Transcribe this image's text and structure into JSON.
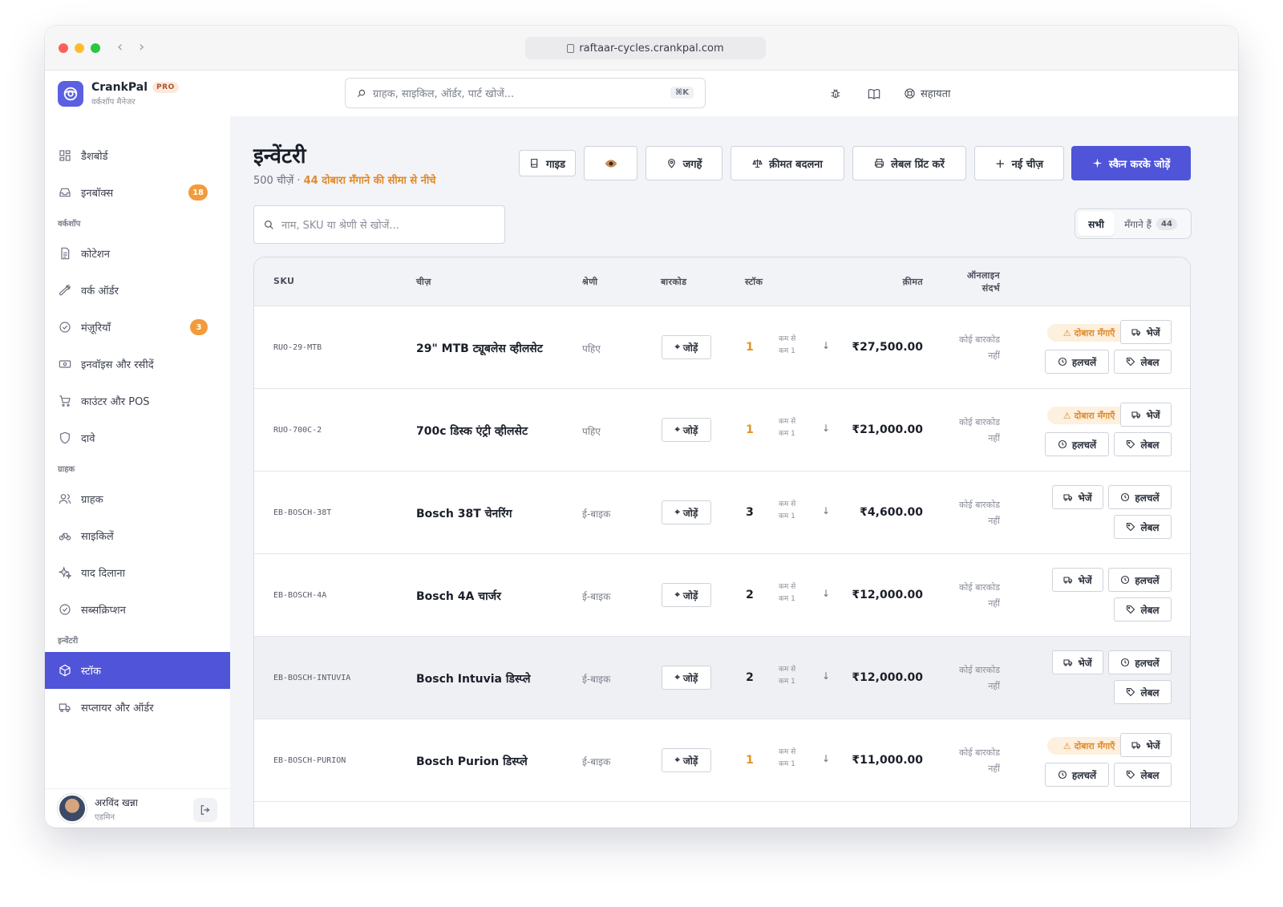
{
  "browser": {
    "url": "raftaar-cycles.crankpal.com"
  },
  "brand": {
    "name": "CrankPal",
    "badge": "PRO",
    "subtitle": "वर्कशॉप मैनेजर"
  },
  "sidebar": {
    "items": [
      {
        "label": "डैशबोर्ड"
      },
      {
        "label": "इनबॉक्स",
        "badge": "18"
      },
      {
        "section": "वर्कशॉप"
      },
      {
        "label": "कोटेशन"
      },
      {
        "label": "वर्क ऑर्डर"
      },
      {
        "label": "मंज़ूरियाँ",
        "badge": "3"
      },
      {
        "label": "इनवॉइस और रसीदें"
      },
      {
        "label": "काउंटर और POS"
      },
      {
        "label": "दावे"
      },
      {
        "section": "ग्राहक"
      },
      {
        "label": "ग्राहक"
      },
      {
        "label": "साइकिलें"
      },
      {
        "label": "याद दिलाना"
      },
      {
        "label": "सब्सक्रिप्शन"
      },
      {
        "section": "इन्वेंटरी"
      },
      {
        "label": "स्टॉक"
      },
      {
        "label": "सप्लायर और ऑर्डर"
      }
    ],
    "user": {
      "name": "अरविंद खन्ना",
      "role": "एडमिन"
    }
  },
  "topbar": {
    "search_placeholder": "ग्राहक, साइकिल, ऑर्डर, पार्ट खोजें...",
    "shortcut": "⌘K",
    "help": "सहायता"
  },
  "page": {
    "title": "इन्वेंटरी",
    "count": "500 चीज़ें",
    "sep": " · ",
    "warning": "44 दोबारा मँगाने की सीमा से नीचे",
    "actions": {
      "guide": "गाइड",
      "locations": "जगहें",
      "price_change": "क़ीमत बदलना",
      "print_labels": "लेबल प्रिंट करें",
      "new_item": "नई चीज़",
      "scan_add": "स्कैन करके जोड़ें"
    },
    "list_search_placeholder": "नाम, SKU या श्रेणी से खोजें...",
    "filter": {
      "all": "सभी",
      "to_order": "मँगाने हैं",
      "to_order_count": "44"
    }
  },
  "table": {
    "columns": {
      "sku": "SKU",
      "item": "चीज़",
      "category": "श्रेणी",
      "barcode": "बारकोड",
      "stock": "स्टॉक",
      "price": "क़ीमत",
      "online_1": "ऑनलाइन",
      "online_2": "संदर्भ"
    },
    "labels": {
      "add": "जोड़ें",
      "min_1": "कम से",
      "min_2": "कम 1",
      "no_barcode_1": "कोई बारकोड",
      "no_barcode_2": "नहीं",
      "reorder": "दोबारा मँगाएँ",
      "send": "भेजें",
      "movements": "हलचलें",
      "label": "लेबल"
    },
    "rows": [
      {
        "sku": "RUO-29-MTB",
        "name": "29\" MTB ट्यूबलेस व्हीलसेट",
        "category": "पहिए",
        "stock": "1",
        "low": true,
        "price": "₹27,500.00"
      },
      {
        "sku": "RUO-700C-2",
        "name": "700c डिस्क एंट्री व्हीलसेट",
        "category": "पहिए",
        "stock": "1",
        "low": true,
        "price": "₹21,000.00"
      },
      {
        "sku": "EB-BOSCH-38T",
        "name": "Bosch 38T चेनरिंग",
        "category": "ई-बाइक",
        "stock": "3",
        "low": false,
        "price": "₹4,600.00"
      },
      {
        "sku": "EB-BOSCH-4A",
        "name": "Bosch 4A चार्जर",
        "category": "ई-बाइक",
        "stock": "2",
        "low": false,
        "price": "₹12,000.00"
      },
      {
        "sku": "EB-BOSCH-INTUVIA",
        "name": "Bosch Intuvia डिस्प्ले",
        "category": "ई-बाइक",
        "stock": "2",
        "low": false,
        "price": "₹12,000.00"
      },
      {
        "sku": "EB-BOSCH-PURION",
        "name": "Bosch Purion डिस्प्ले",
        "category": "ई-बाइक",
        "stock": "1",
        "low": true,
        "price": "₹11,000.00"
      }
    ]
  },
  "colors": {
    "accent": "#4f54d8",
    "warning": "#e08a2b",
    "badge": "#f29b3c"
  }
}
